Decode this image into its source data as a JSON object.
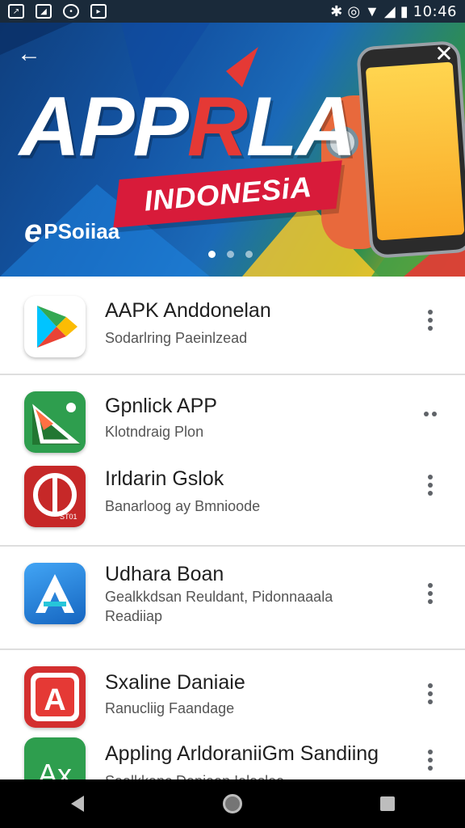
{
  "status_bar": {
    "time": "10:46",
    "left_icons": [
      "chart-icon",
      "image-icon",
      "circle-icon",
      "message-icon"
    ],
    "right_icons": [
      "bluetooth-icon",
      "vibrate-icon",
      "wifi-icon",
      "signal-icon",
      "battery-icon"
    ]
  },
  "banner": {
    "title_part1": "APP",
    "title_accent": "R",
    "title_part2": "LA",
    "ribbon": "INDONESiA",
    "logo_letter": "e",
    "logo_text": "PSoiiaa",
    "pages": 3,
    "active_page": 1
  },
  "apps": [
    {
      "name": "AAPK Anddonelan",
      "subtitle": "Sodarlring Paeinlzead",
      "icon": "play-store-icon"
    },
    {
      "name": "Gpnlick APP",
      "subtitle": "Klotndraig Plon",
      "icon": "green-triangle-icon"
    },
    {
      "name": "Irldarin Gslok",
      "subtitle": "Banarloog ay Bmnioode",
      "icon": "red-db-icon"
    },
    {
      "name": "Udhara Boan",
      "subtitle": "Gealkkdsan Reuldant, Pidonnaaala",
      "subtitle2": "Readiiap",
      "icon": "blue-a-icon"
    },
    {
      "name": "Sxaline Daniaie",
      "subtitle": "Ranucliig Faandage",
      "icon": "red-a-icon"
    },
    {
      "name": "Appling ArldoraniiGm Sandiing",
      "subtitle": "Saalkkanc Daniaan Ialaslea",
      "icon": "green-ax-icon"
    }
  ],
  "colors": {
    "status_bar": "#1a2a3a",
    "ribbon": "#d81b3a",
    "nav_bar": "#000000"
  }
}
